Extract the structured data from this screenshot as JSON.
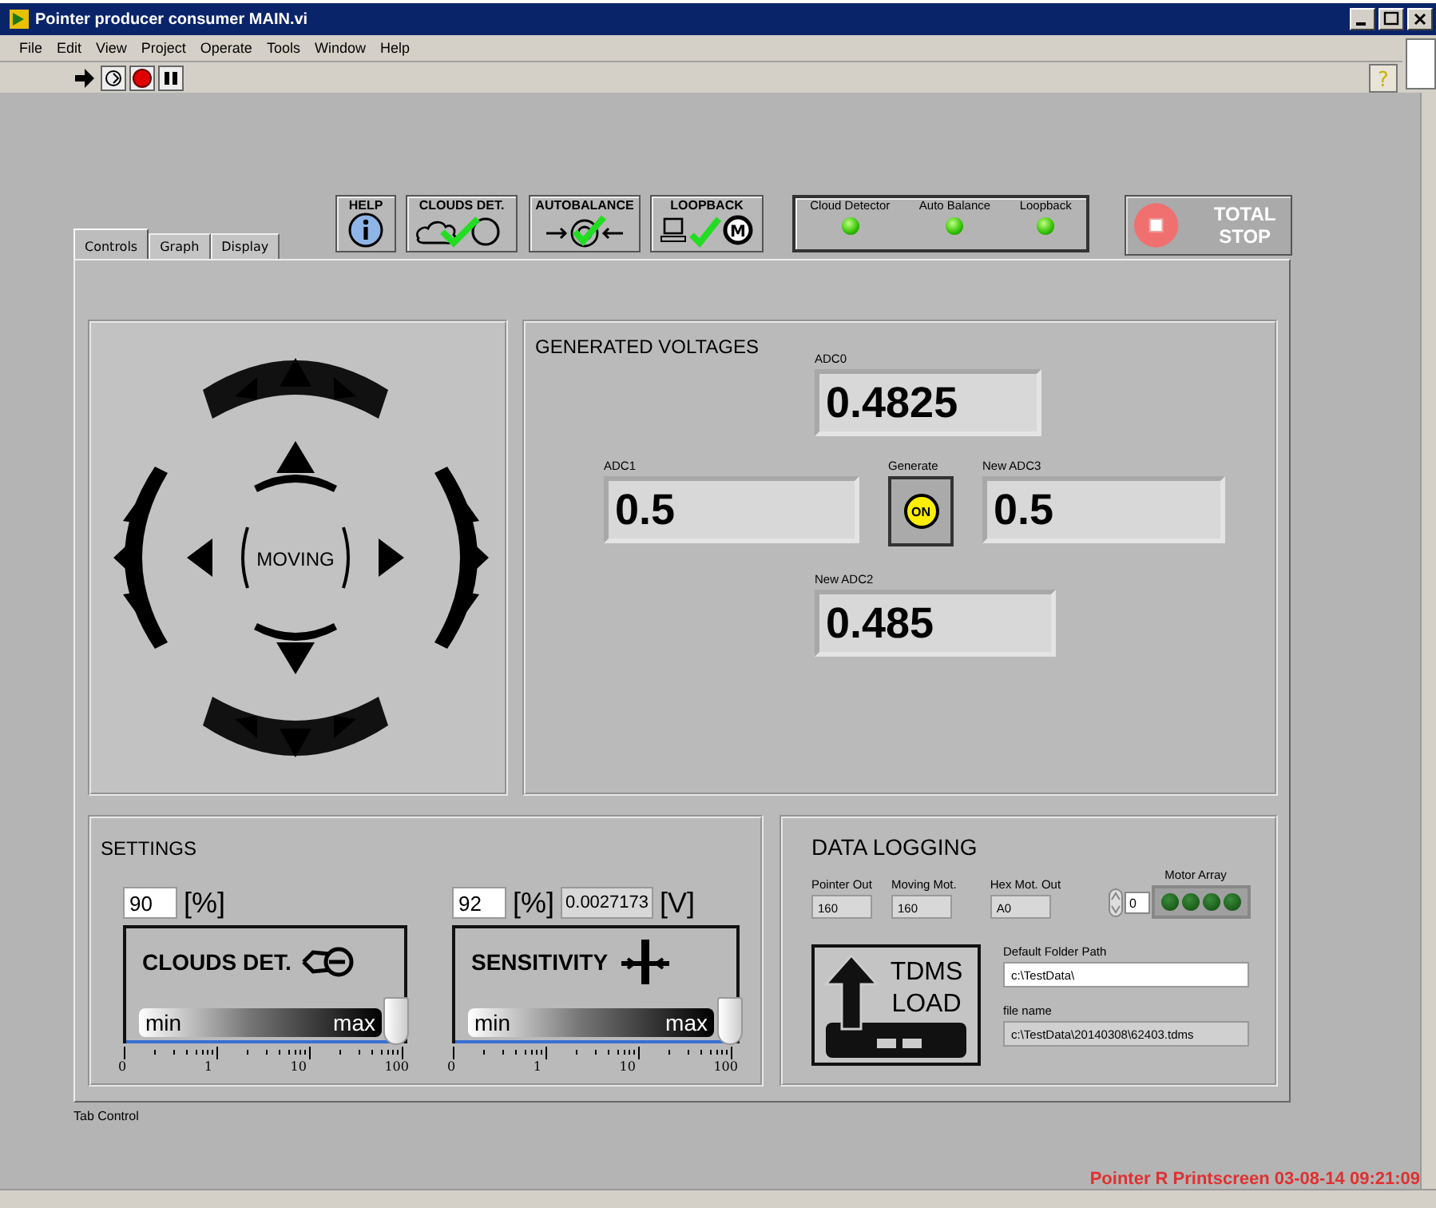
{
  "window": {
    "title": "Pointer producer consumer MAIN.vi"
  },
  "menu": [
    "File",
    "Edit",
    "View",
    "Project",
    "Operate",
    "Tools",
    "Window",
    "Help"
  ],
  "top_buttons": [
    {
      "label": "HELP",
      "kind": "help"
    },
    {
      "label": "CLOUDS DET.",
      "kind": "clouds"
    },
    {
      "label": "AUTOBALANCE",
      "kind": "autobalance"
    },
    {
      "label": "LOOPBACK",
      "kind": "loopback",
      "icon_text": "M"
    }
  ],
  "toolbar_help": "?",
  "status_leds": [
    {
      "label": "Cloud Detector",
      "on": true
    },
    {
      "label": "Auto Balance",
      "on": true
    },
    {
      "label": "Loopback",
      "on": true
    }
  ],
  "total_stop": {
    "label": "TOTAL STOP"
  },
  "tabs": [
    {
      "label": "Controls",
      "selected": true
    },
    {
      "label": "Graph",
      "selected": false
    },
    {
      "label": "Display",
      "selected": false
    }
  ],
  "joystick": {
    "label": "MOVING"
  },
  "voltages": {
    "title": "GENERATED VOLTAGES",
    "adc0": {
      "label": "ADC0",
      "value": "0.4825"
    },
    "adc1": {
      "label": "ADC1",
      "value": "0.5"
    },
    "generate": {
      "label": "Generate",
      "button": "ON",
      "on": true
    },
    "adc3": {
      "label": "New ADC3",
      "value": "0.5"
    },
    "adc2": {
      "label": "New ADC2",
      "value": "0.485"
    }
  },
  "settings": {
    "title": "SETTINGS",
    "sliders": [
      {
        "kind": "clouds",
        "value": "90",
        "unit": "[%]",
        "name": "CLOUDS DET.",
        "min_label": "min",
        "max_label": "max",
        "level": 0.98,
        "scale_labels": [
          "0",
          "1",
          "10",
          "100"
        ]
      },
      {
        "kind": "sensitivity",
        "value": "92",
        "unit": "[%]",
        "voltage": "0.0027173",
        "voltage_unit": "[V]",
        "name": "SENSITIVITY",
        "min_label": "min",
        "max_label": "max",
        "level": 0.99,
        "scale_labels": [
          "0",
          "1",
          "10",
          "100"
        ]
      }
    ]
  },
  "data_logging": {
    "title": "DATA LOGGING",
    "outputs": [
      {
        "label": "Pointer Out",
        "value": "160"
      },
      {
        "label": "Moving Mot.",
        "value": "160"
      },
      {
        "label": "Hex Mot. Out",
        "value": "A0"
      }
    ],
    "motor_array": {
      "label": "Motor Array",
      "index": "0",
      "leds": [
        {
          "on": false
        },
        {
          "on": false
        },
        {
          "on": false
        },
        {
          "on": false
        }
      ]
    },
    "tdms_button": {
      "label": "TDMS LOAD"
    },
    "folder": {
      "label": "Default Folder Path",
      "value": "c:\\TestData\\"
    },
    "file": {
      "label": "file name",
      "value": "c:\\TestData\\20140308\\62403.tdms"
    }
  },
  "tab_control_label": "Tab Control",
  "screenshot_stamp": "Pointer R Printscreen 03-08-14 09:21:09"
}
